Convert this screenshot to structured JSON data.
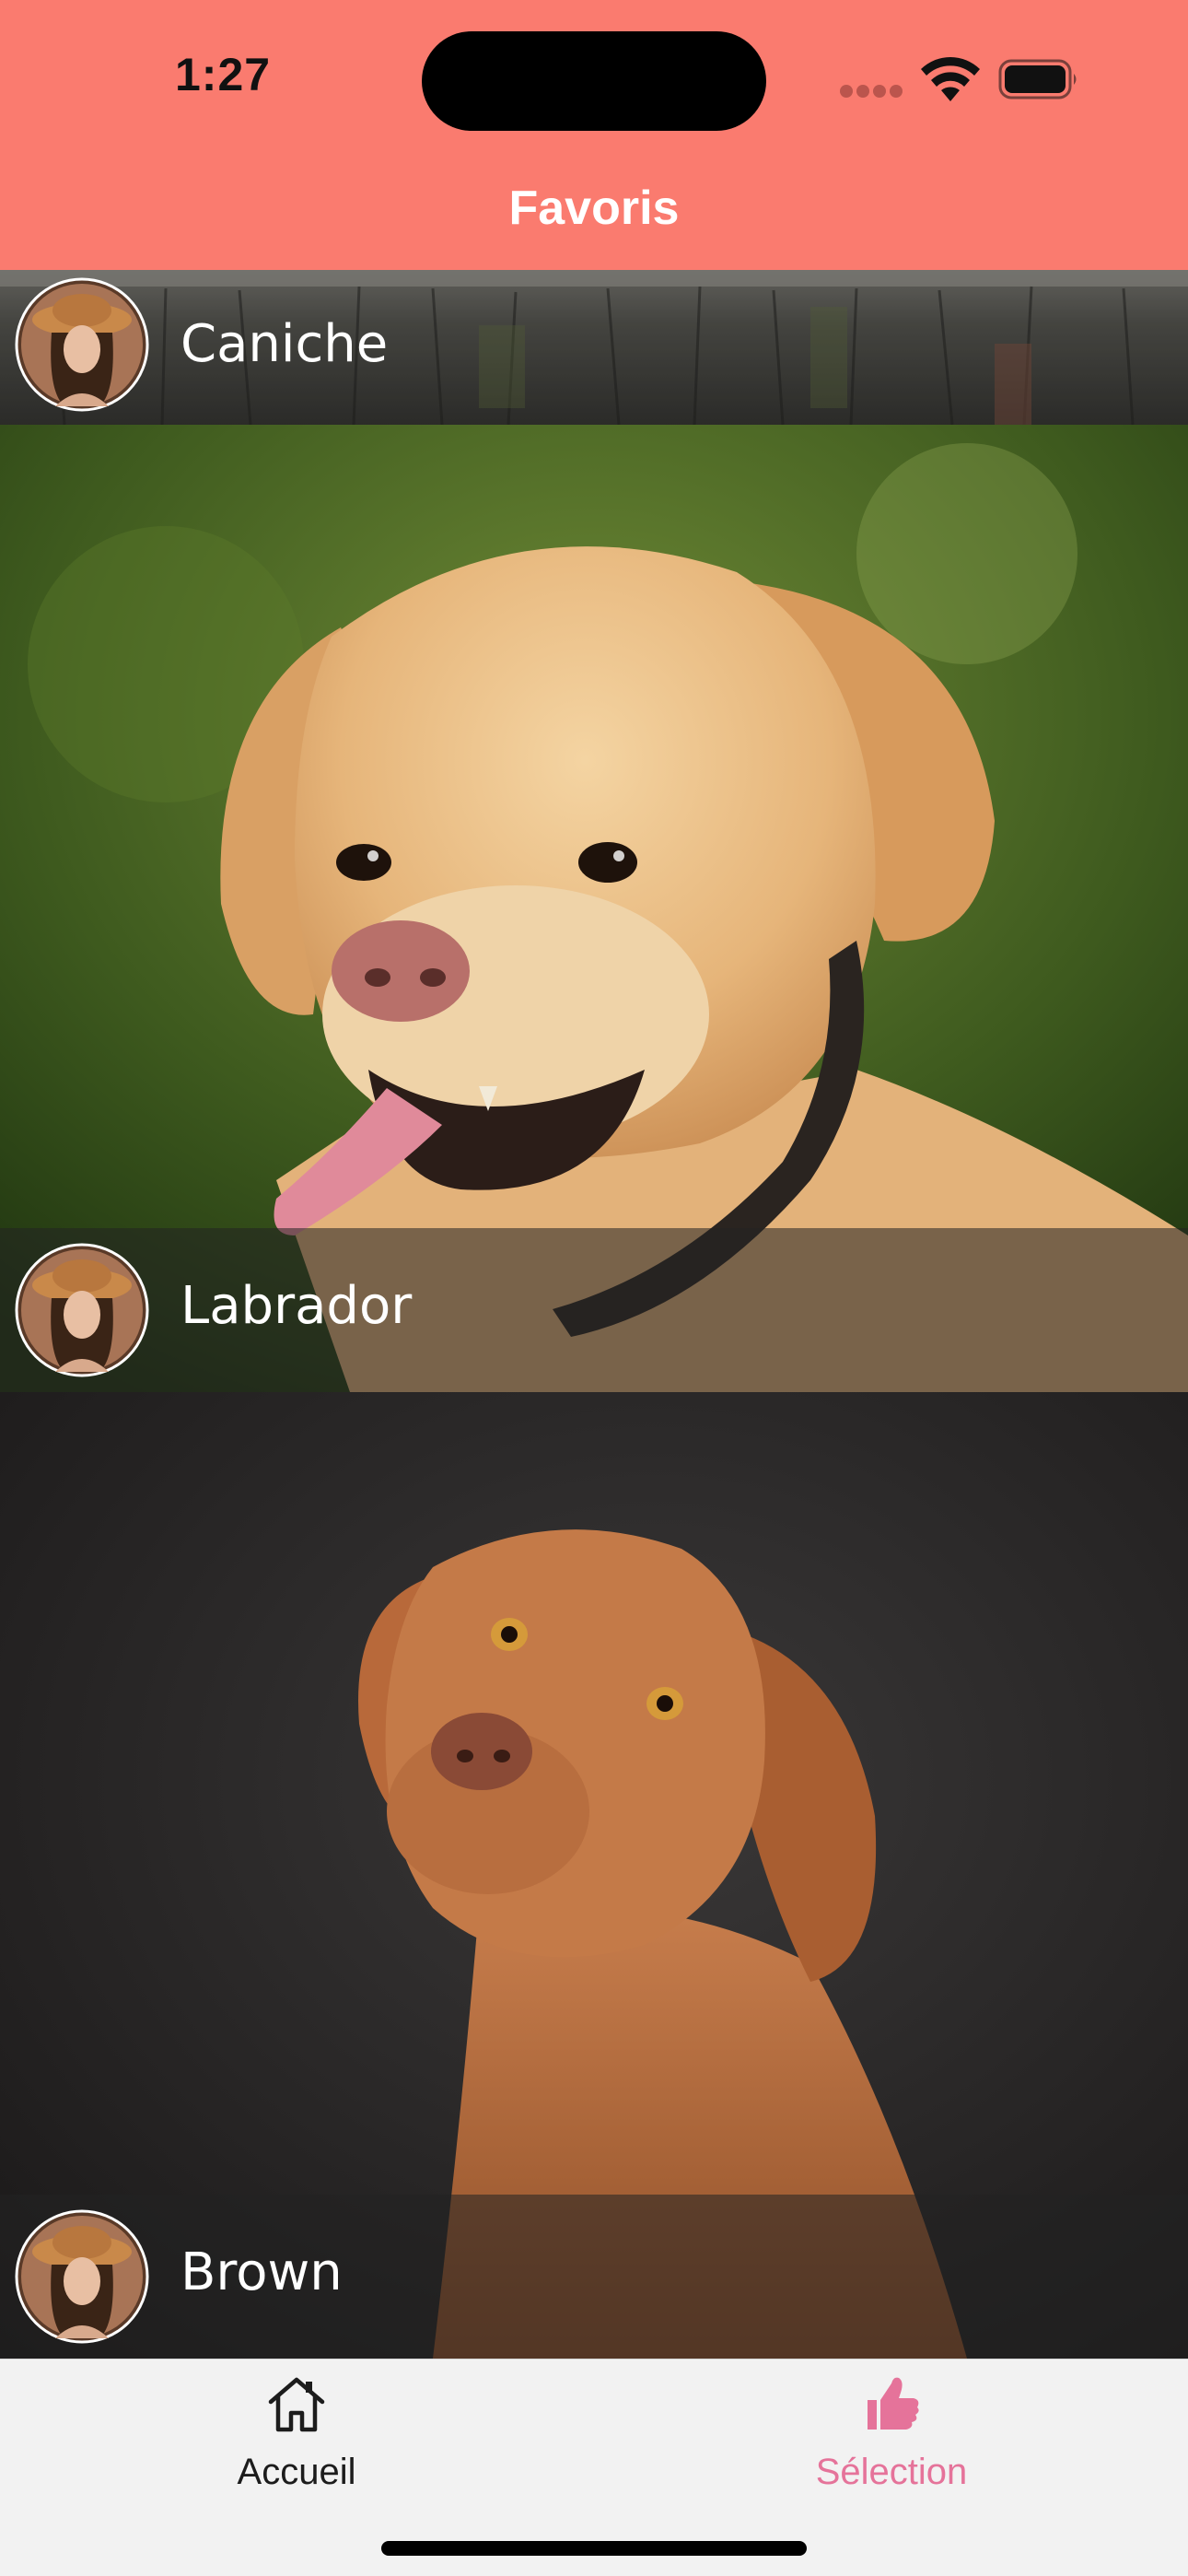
{
  "status": {
    "time": "1:27"
  },
  "header": {
    "title": "Favoris",
    "color": "#fa7b6f"
  },
  "cards": [
    {
      "label": "Caniche",
      "photo": "dog-caniche-photo",
      "avatar": "profile-avatar"
    },
    {
      "label": "Labrador",
      "photo": "dog-labrador-photo",
      "avatar": "profile-avatar"
    },
    {
      "label": "Brown",
      "photo": "dog-brown-photo",
      "avatar": "profile-avatar"
    }
  ],
  "tabs": [
    {
      "label": "Accueil",
      "icon": "home-icon",
      "color": "#1c1c1c",
      "active": false
    },
    {
      "label": "Sélection",
      "icon": "thumbs-up-icon",
      "color": "#e5739a",
      "active": true
    }
  ]
}
